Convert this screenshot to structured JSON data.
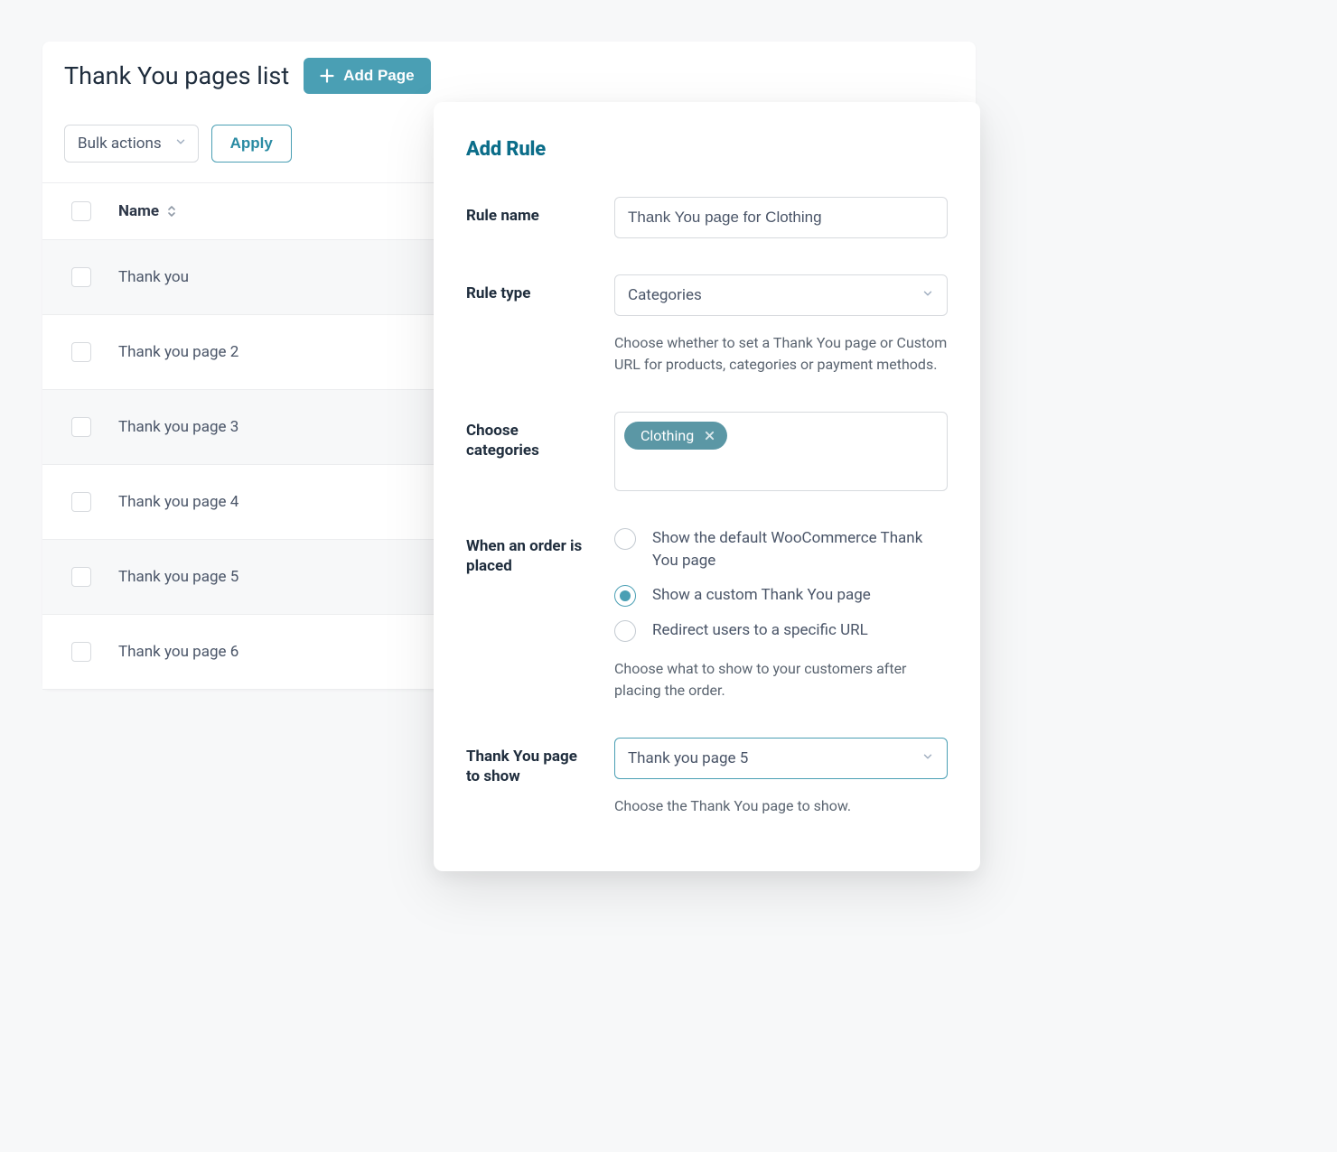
{
  "header": {
    "title": "Thank You pages list",
    "add_page_label": "Add Page"
  },
  "toolbar": {
    "bulk_actions_label": "Bulk actions",
    "apply_label": "Apply"
  },
  "table": {
    "column_name": "Name",
    "rows": [
      {
        "name": "Thank you"
      },
      {
        "name": "Thank you page 2"
      },
      {
        "name": "Thank you page 3"
      },
      {
        "name": "Thank you page 4"
      },
      {
        "name": "Thank you page 5"
      },
      {
        "name": "Thank you page 6"
      }
    ]
  },
  "panel": {
    "title": "Add Rule",
    "rule_name_label": "Rule name",
    "rule_name_value": "Thank You page for Clothing",
    "rule_type_label": "Rule type",
    "rule_type_value": "Categories",
    "rule_type_help": "Choose whether to set a Thank You page or Custom URL for products, categories or payment methods.",
    "choose_categories_label": "Choose categories",
    "category_tag": "Clothing",
    "when_order_label": "When an order is placed",
    "radio_options": [
      "Show the default WooCommerce Thank You page",
      "Show a custom Thank You page",
      "Redirect users to a specific URL"
    ],
    "radio_selected_index": 1,
    "when_order_help": "Choose what to show to your customers after placing the order.",
    "page_to_show_label": "Thank You page to show",
    "page_to_show_value": "Thank you page 5",
    "page_to_show_help": "Choose the Thank You page to show."
  }
}
